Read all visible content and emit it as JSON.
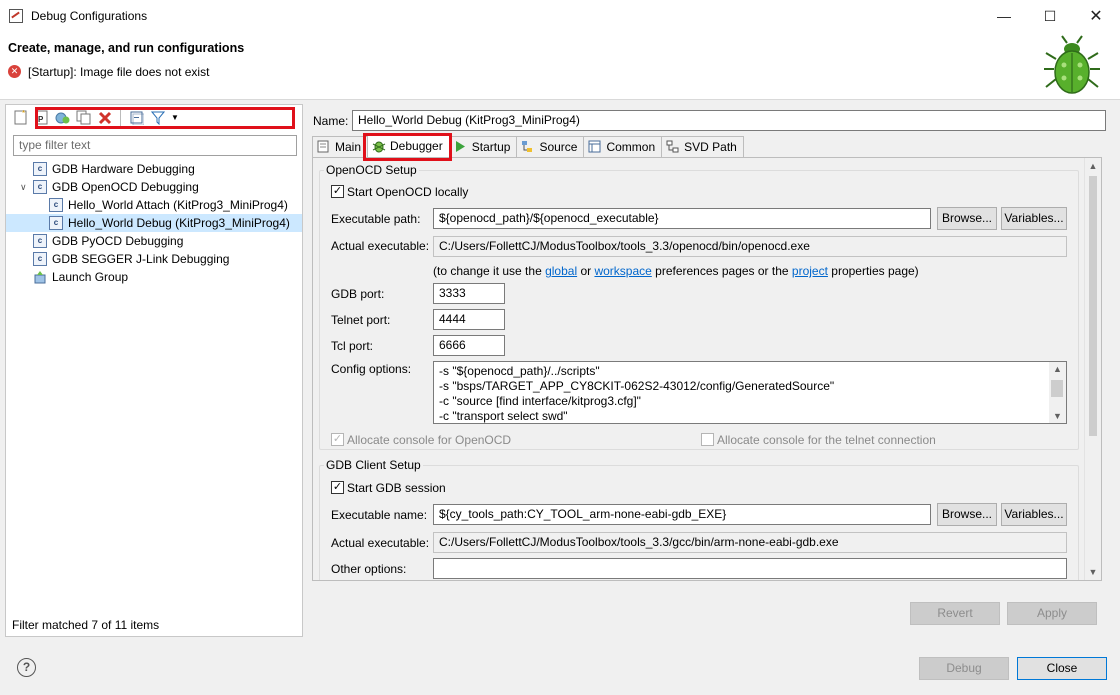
{
  "window": {
    "title": "Debug Configurations"
  },
  "header": {
    "title": "Create, manage, and run configurations",
    "message": "[Startup]: Image file does not exist"
  },
  "left": {
    "filter_placeholder": "type filter text",
    "tree": [
      {
        "label": "GDB Hardware Debugging",
        "level": 0,
        "expanded": false
      },
      {
        "label": "GDB OpenOCD Debugging",
        "level": 0,
        "expanded": true
      },
      {
        "label": "Hello_World Attach (KitProg3_MiniProg4)",
        "level": 1
      },
      {
        "label": "Hello_World Debug (KitProg3_MiniProg4)",
        "level": 1,
        "selected": true
      },
      {
        "label": "GDB PyOCD Debugging",
        "level": 0
      },
      {
        "label": "GDB SEGGER J-Link Debugging",
        "level": 0
      },
      {
        "label": "Launch Group",
        "level": 0
      }
    ],
    "status": "Filter matched 7 of 11 items"
  },
  "right": {
    "name_label": "Name:",
    "name_value": "Hello_World Debug (KitProg3_MiniProg4)",
    "tabs": [
      {
        "label": "Main",
        "icon": "main-tab-icon"
      },
      {
        "label": "Debugger",
        "icon": "bug-icon",
        "active": true
      },
      {
        "label": "Startup",
        "icon": "startup-icon"
      },
      {
        "label": "Source",
        "icon": "source-icon"
      },
      {
        "label": "Common",
        "icon": "common-icon"
      },
      {
        "label": "SVD Path",
        "icon": "svd-icon"
      }
    ],
    "openocd": {
      "group_label": "OpenOCD Setup",
      "start_locally": "Start OpenOCD locally",
      "exec_path_label": "Executable path:",
      "exec_path_value": "${openocd_path}/${openocd_executable}",
      "browse": "Browse...",
      "variables": "Variables...",
      "actual_exec_label": "Actual executable:",
      "actual_exec_value": "C:/Users/FollettCJ/ModusToolbox/tools_3.3/openocd/bin/openocd.exe",
      "note_prefix": "(to change it use the ",
      "link_global": "global",
      "note_or": " or ",
      "link_workspace": "workspace",
      "note_mid": " preferences pages or the ",
      "link_project": "project",
      "note_suffix": " properties page)",
      "gdb_port_label": "GDB port:",
      "gdb_port": "3333",
      "telnet_port_label": "Telnet port:",
      "telnet_port": "4444",
      "tcl_port_label": "Tcl port:",
      "tcl_port": "6666",
      "config_label": "Config options:",
      "config_lines": [
        "-s \"${openocd_path}/../scripts\"",
        "-s \"bsps/TARGET_APP_CY8CKIT-062S2-43012/config/GeneratedSource\"",
        "-c \"source [find interface/kitprog3.cfg]\"",
        "-c \"transport select swd\""
      ],
      "alloc_console": "Allocate console for OpenOCD",
      "alloc_telnet": "Allocate console for the telnet connection"
    },
    "gdb_client": {
      "group_label": "GDB Client Setup",
      "start_session": "Start GDB session",
      "exec_name_label": "Executable name:",
      "exec_name_value": "${cy_tools_path:CY_TOOL_arm-none-eabi-gdb_EXE}",
      "browse": "Browse...",
      "variables": "Variables...",
      "actual_exec_label": "Actual executable:",
      "actual_exec_value": "C:/Users/FollettCJ/ModusToolbox/tools_3.3/gcc/bin/arm-none-eabi-gdb.exe",
      "other_options_label": "Other options:",
      "other_options_value": ""
    },
    "revert": "Revert",
    "apply": "Apply"
  },
  "footer": {
    "debug": "Debug",
    "close": "Close"
  },
  "colors": {
    "highlight_red": "#e0101a",
    "link": "#0066cc",
    "selection": "#cce8ff"
  }
}
